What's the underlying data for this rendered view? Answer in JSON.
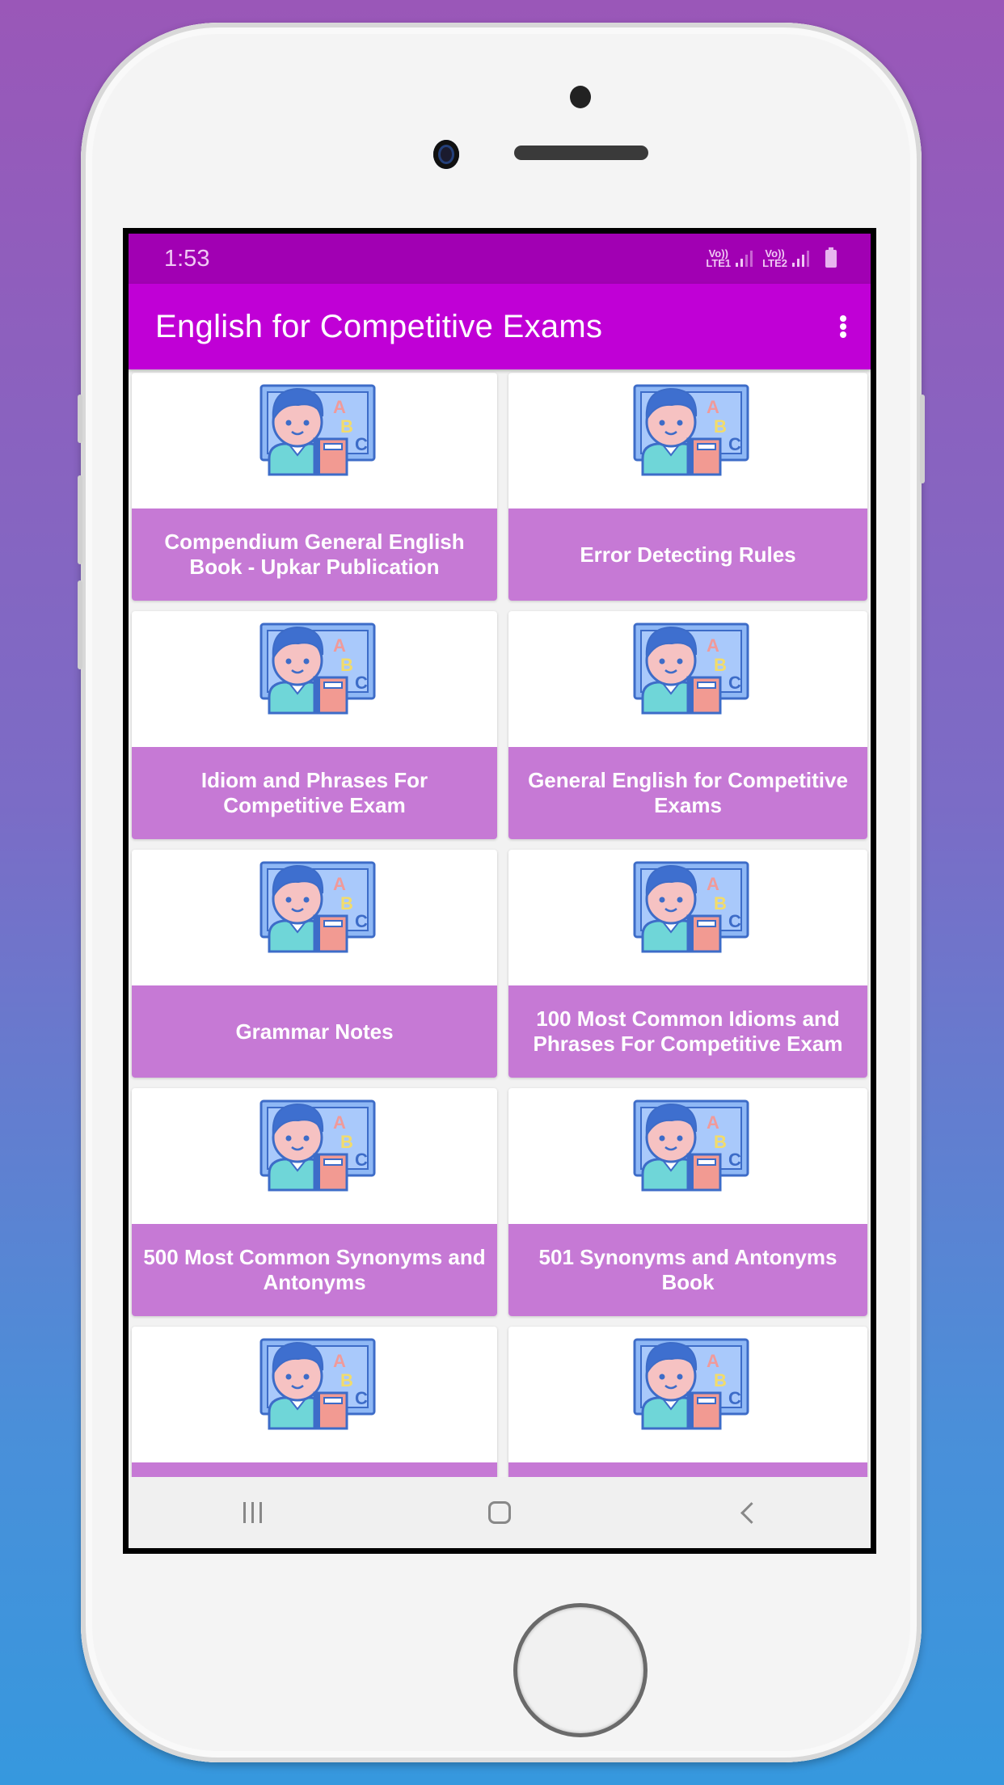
{
  "status_bar": {
    "time": "1:53",
    "sim1": {
      "top": "Vo))",
      "bottom": "LTE1"
    },
    "sim2": {
      "top": "Vo))",
      "bottom": "LTE2"
    }
  },
  "app_bar": {
    "title": "English for Competitive Exams",
    "menu_icon": "more-vert-icon"
  },
  "cards": [
    {
      "label": "Compendium General English Book - Upkar Publication",
      "icon": "teacher-abc-icon"
    },
    {
      "label": "Error Detecting Rules",
      "icon": "teacher-abc-icon"
    },
    {
      "label": "Idiom and Phrases For Competitive Exam",
      "icon": "teacher-abc-icon"
    },
    {
      "label": "General English for Competitive Exams",
      "icon": "teacher-abc-icon"
    },
    {
      "label": "Grammar Notes",
      "icon": "teacher-abc-icon"
    },
    {
      "label": "100 Most Common Idioms and Phrases For Competitive Exam",
      "icon": "teacher-abc-icon"
    },
    {
      "label": "500 Most Common Synonyms and Antonyms",
      "icon": "teacher-abc-icon"
    },
    {
      "label": "501 Synonyms and Antonyms Book",
      "icon": "teacher-abc-icon"
    },
    {
      "label": "",
      "icon": "teacher-abc-icon"
    },
    {
      "label": "",
      "icon": "teacher-abc-icon"
    }
  ],
  "nav_bar": {
    "recent": "recent-apps-icon",
    "home": "home-icon",
    "back": "back-icon"
  },
  "colors": {
    "status_bar": "#a100b3",
    "app_bar": "#c000d6",
    "card_label": "#c679d5"
  }
}
